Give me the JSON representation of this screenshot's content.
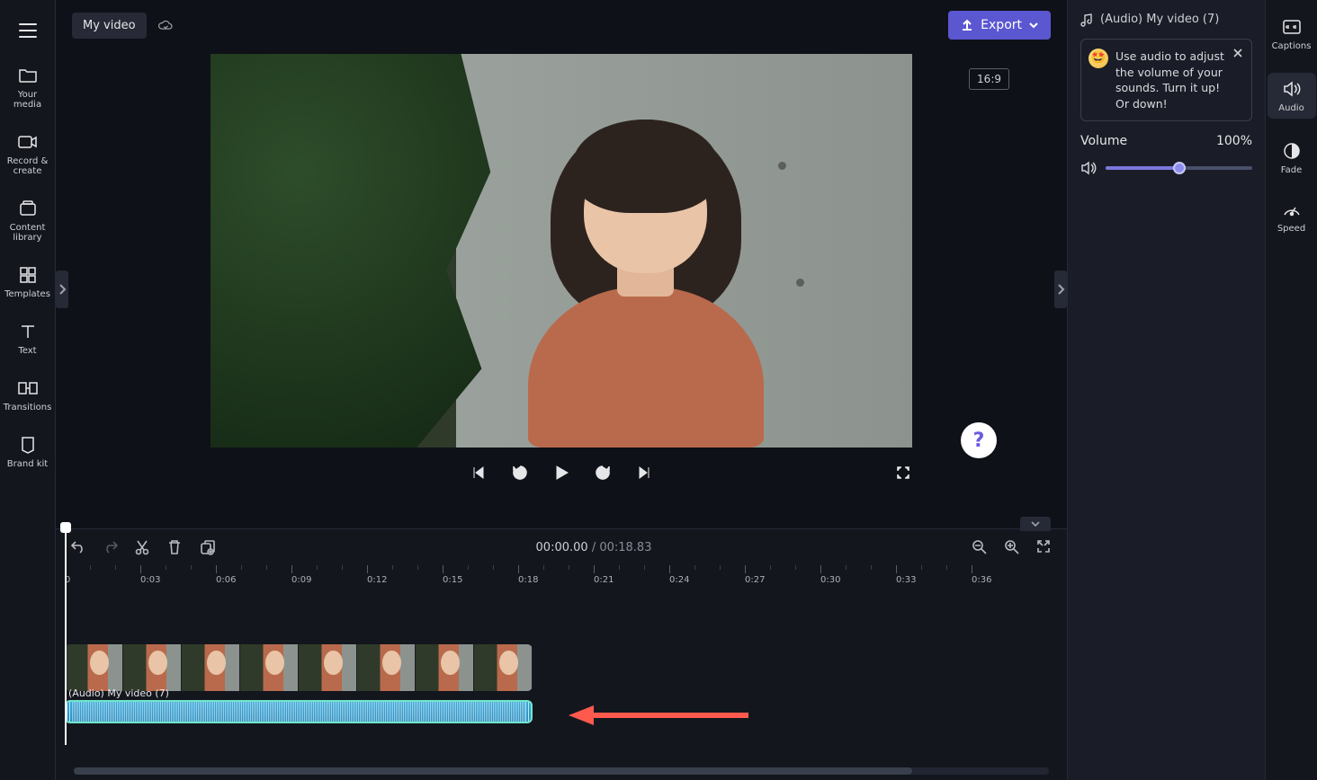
{
  "project": {
    "title": "My video"
  },
  "leftNav": {
    "items": [
      {
        "label": "Your media"
      },
      {
        "label": "Record & create"
      },
      {
        "label": "Content library"
      },
      {
        "label": "Templates"
      },
      {
        "label": "Text"
      },
      {
        "label": "Transitions"
      },
      {
        "label": "Brand kit"
      }
    ]
  },
  "header": {
    "export_label": "Export",
    "aspect_ratio": "16:9"
  },
  "transport": {
    "current_time": "00:00.00",
    "duration": "00:18.83"
  },
  "ruler": {
    "labels": [
      "0",
      "0:03",
      "0:06",
      "0:09",
      "0:12",
      "0:15",
      "0:18",
      "0:21",
      "0:24",
      "0:27",
      "0:30",
      "0:33",
      "0:36"
    ]
  },
  "tracks": {
    "audio_label": "(Audio) My video (7)"
  },
  "rightPanel": {
    "clip_title": "(Audio) My video (7)",
    "tip_text": "Use audio to adjust the volume of your sounds. Turn it up! Or down!",
    "volume_label": "Volume",
    "volume_value": "100%",
    "volume_fill_pct": 50
  },
  "rightRail": {
    "items": [
      {
        "label": "Captions"
      },
      {
        "label": "Audio"
      },
      {
        "label": "Fade"
      },
      {
        "label": "Speed"
      }
    ]
  }
}
